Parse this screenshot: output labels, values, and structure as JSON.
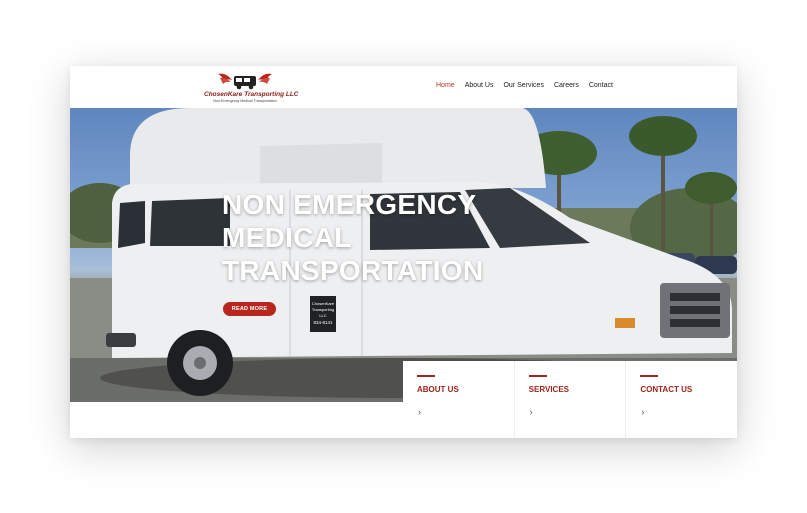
{
  "brand": {
    "name": "ChosenKare Transporting LLC",
    "tagline": "Non-Emergency Medical Transportation"
  },
  "nav": {
    "items": [
      "Home",
      "About Us",
      "Our Services",
      "Careers",
      "Contact"
    ],
    "active": "Home"
  },
  "hero": {
    "title_lines": [
      "NON EMERGENCY",
      "MEDICAL",
      "TRANSPORTATION"
    ],
    "button_label": "READ MORE",
    "van_door_text": [
      "ChosenKare",
      "Transporting",
      "LLC",
      "834-8141"
    ]
  },
  "cards": [
    {
      "title": "ABOUT US",
      "arrow": "›"
    },
    {
      "title": "SERVICES",
      "arrow": "›"
    },
    {
      "title": "CONTACT US",
      "arrow": "›"
    }
  ],
  "colors": {
    "accent": "#b8271e",
    "card_title": "#a0241b",
    "nav_active": "#b8322a"
  },
  "icons": {
    "logo": "winged-van-logo-icon",
    "card_arrow": "chevron-right-icon"
  }
}
